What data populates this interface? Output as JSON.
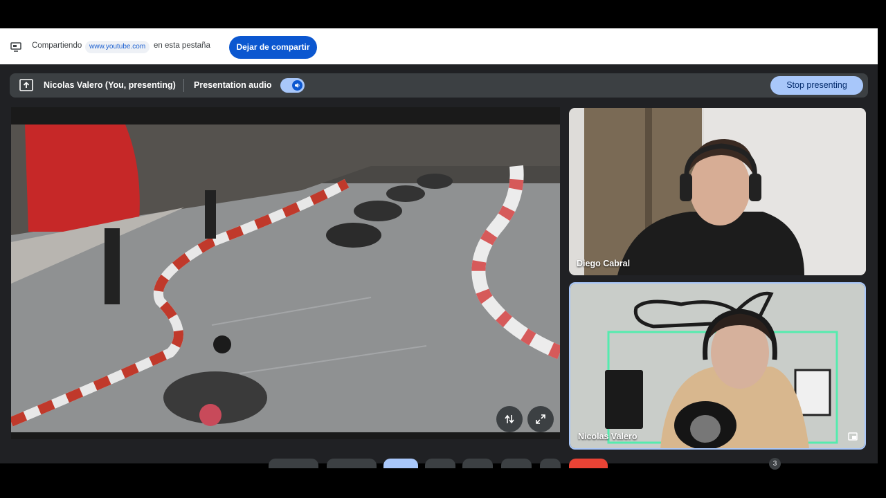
{
  "share_bar": {
    "prefix": "Compartiendo",
    "url": "www.youtube.com",
    "suffix": "en esta pestaña",
    "stop_sharing_label": "Dejar de compartir"
  },
  "present_bar": {
    "presenter": "Nicolas Valero (You, presenting)",
    "audio_label": "Presentation audio",
    "audio_enabled": true,
    "stop_label": "Stop presenting"
  },
  "participants": [
    {
      "name": "Diego Cabral"
    },
    {
      "name": "Nicolas Valero"
    }
  ],
  "hidden_count": "3",
  "colors": {
    "accent": "#0b57d0",
    "pill": "#a8c7fa",
    "surface": "#202124",
    "end_call": "#ea4335"
  }
}
